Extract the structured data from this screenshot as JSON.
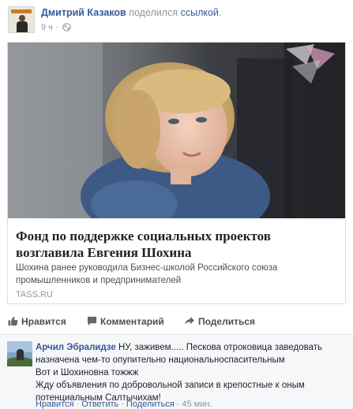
{
  "post": {
    "author": "Дмитрий Казаков",
    "shared_text": "поделился",
    "shared_link": "ссылкой",
    "shared_period": ".",
    "time": "9 ч",
    "time_sep": "·"
  },
  "link_card": {
    "title": "Фонд по поддержке социальных проектов возглавила Евгения Шохина",
    "description": "Шохина ранее руководила Бизнес-школой Российского союза промышленников и предпринимателей",
    "source": "TASS.RU"
  },
  "actions": {
    "like": "Нравится",
    "comment": "Комментарий",
    "share": "Поделиться"
  },
  "comment": {
    "author": "Арчил Эбралидзе",
    "lines": [
      "НУ, заживем..... Пескова отроковица заведовать",
      "назначена чем-то опупительно национальноспасительным",
      "Вот и Шохиновна тожжж",
      "Жду объявления по добровольной записи в крепостные к оным",
      "потенциальным Салтычихам!"
    ],
    "like": "Нравится",
    "reply": "Ответить",
    "share": "Поделиться",
    "time": "45 мин.",
    "separator": "·"
  },
  "colors": {
    "link_blue": "#365899",
    "muted_gray": "#90949c",
    "text": "#1d2129"
  }
}
